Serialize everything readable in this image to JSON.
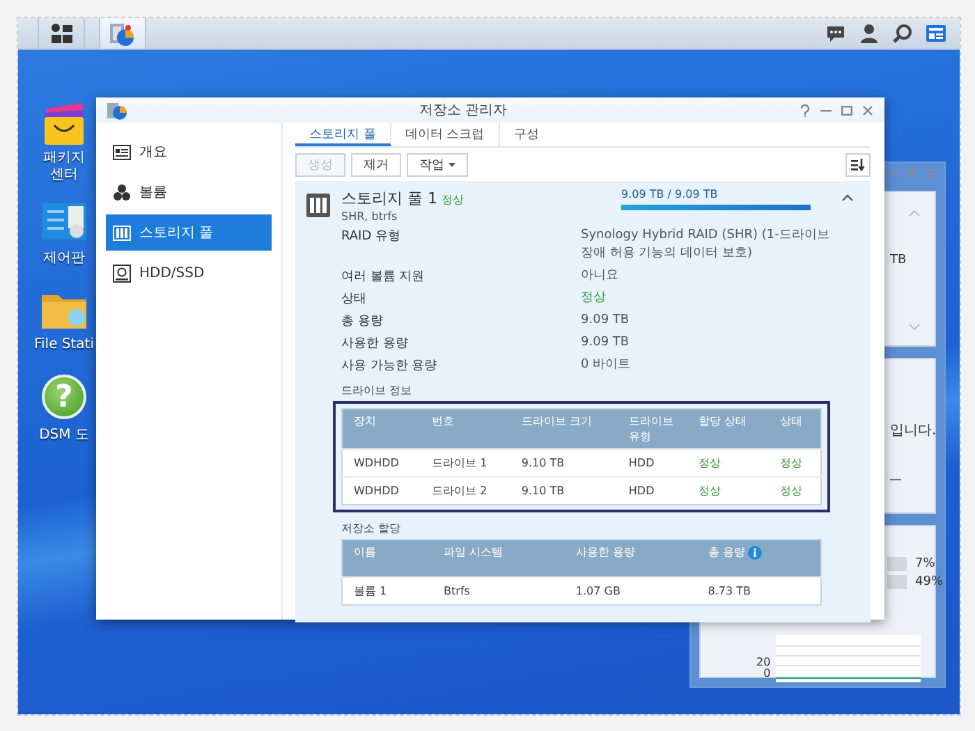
{
  "taskbar": {
    "apps": [
      {
        "kind": "main-menu",
        "selected": false
      },
      {
        "kind": "storage",
        "selected": true
      }
    ],
    "tray": [
      {
        "kind": "chat"
      },
      {
        "kind": "user"
      },
      {
        "kind": "search"
      },
      {
        "kind": "widgets"
      }
    ]
  },
  "desktop_icons": [
    {
      "kind": "package",
      "label": "패키지 센터"
    },
    {
      "kind": "control",
      "label": "제어판"
    },
    {
      "kind": "folder",
      "label": "File Stati"
    },
    {
      "kind": "help",
      "glyph": "?",
      "label": "DSM 도"
    }
  ],
  "window": {
    "title": "저장소 관리자",
    "sidebar": [
      {
        "kind": "overview",
        "label": "개요",
        "selected": false
      },
      {
        "kind": "volume",
        "label": "볼륨",
        "selected": false
      },
      {
        "kind": "pool",
        "label": "스토리지 풀",
        "selected": true
      },
      {
        "kind": "disk",
        "label": "HDD/SSD",
        "selected": false
      }
    ],
    "tabs": [
      {
        "label": "스토리지 풀",
        "selected": true
      },
      {
        "label": "데이터 스크럽",
        "selected": false
      },
      {
        "label": "구성",
        "selected": false
      }
    ],
    "toolbar": [
      {
        "label": "생성",
        "disabled": true,
        "kind": "button"
      },
      {
        "label": "제거",
        "disabled": false,
        "kind": "button"
      },
      {
        "label": "작업",
        "disabled": false,
        "kind": "dropdown"
      }
    ],
    "pool": {
      "name": "스토리지 풀 1",
      "status": "정상",
      "subtitle": "SHR, btrfs",
      "usage": "9.09 TB / 9.09 TB",
      "level": 1,
      "expanded": true,
      "properties": [
        {
          "label": "RAID 유형",
          "value": "Synology Hybrid RAID (SHR) (1-드라이브 장애 허용 기능의 데이터 보호)",
          "kind": "text"
        },
        {
          "label": "여러 볼륨 지원",
          "value": "아니요",
          "kind": "text"
        },
        {
          "label": "상태",
          "value": "정상",
          "kind": "status"
        },
        {
          "label": "총 용량",
          "value": "9.09 TB",
          "kind": "text"
        },
        {
          "label": "사용한 용량",
          "value": "9.09 TB",
          "kind": "text"
        },
        {
          "label": "사용 가능한 용량",
          "value": "0 바이트",
          "kind": "text"
        }
      ],
      "drive_info": {
        "title": "드라이브 정보",
        "highlighted": true,
        "columns": [
          {
            "label": "장치",
            "kind": "text"
          },
          {
            "label": "번호",
            "kind": "text"
          },
          {
            "label": "드라이브 크기",
            "kind": "text"
          },
          {
            "label": "드라이브 유형",
            "kind": "text"
          },
          {
            "label": "할당 상태",
            "kind": "status"
          },
          {
            "label": "상태",
            "kind": "status"
          }
        ],
        "rows": [
          [
            "WDHDD",
            "드라이브 1",
            "9.10 TB",
            "HDD",
            "정상",
            "정상"
          ],
          [
            "WDHDD",
            "드라이브 2",
            "9.10 TB",
            "HDD",
            "정상",
            "정상"
          ]
        ]
      },
      "allocation": {
        "title": "저장소 할당",
        "columns": [
          {
            "label": "이름",
            "kind": "text"
          },
          {
            "label": "파일 시스템",
            "kind": "text"
          },
          {
            "label": "사용한 용량",
            "kind": "text"
          },
          {
            "label": "총 용량",
            "kind": "text",
            "info": true
          }
        ],
        "rows": [
          [
            "볼륨 1",
            "Btrfs",
            "1.07 GB",
            "8.73 TB"
          ]
        ]
      }
    }
  },
  "widgets": {
    "cards": [
      {
        "kind": "storage",
        "text": "TB"
      },
      {
        "kind": "message",
        "text": "입니다."
      },
      {
        "kind": "resource",
        "legend": [
          {
            "value": "7%"
          },
          {
            "value": "49%"
          }
        ],
        "axis": [
          "20",
          "0"
        ]
      }
    ]
  }
}
